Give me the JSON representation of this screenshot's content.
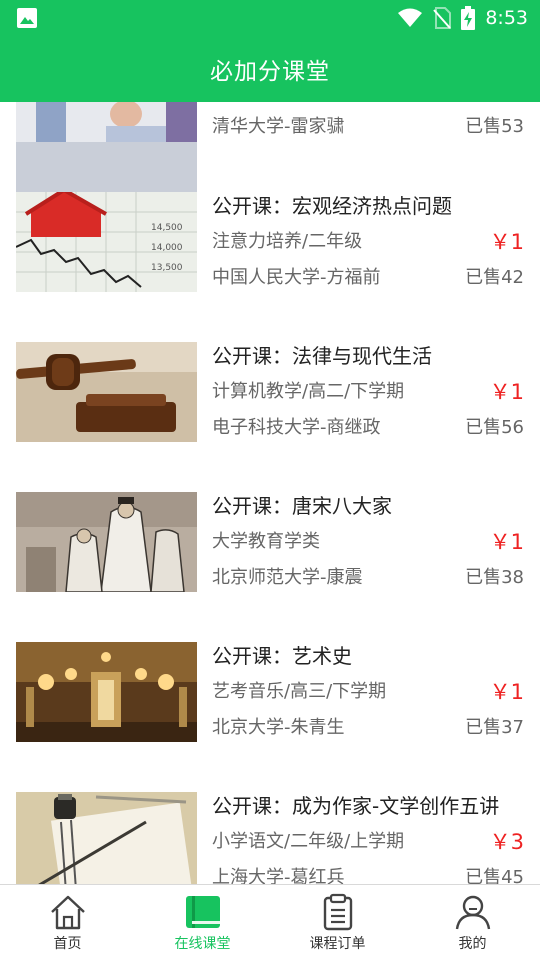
{
  "status_bar": {
    "time": "8:53"
  },
  "header": {
    "title": "必加分课堂"
  },
  "courses": [
    {
      "title": "",
      "category": "",
      "price": "",
      "teacher": "清华大学-雷家骕",
      "sold": "已售53",
      "thumb": "business-people-photo"
    },
    {
      "title": "公开课：宏观经济热点问题",
      "category": "注意力培养/二年级",
      "price": "￥1",
      "teacher": "中国人民大学-方福前",
      "sold": "已售42",
      "thumb": "house-and-stock-chart-photo"
    },
    {
      "title": "公开课：法律与现代生活",
      "category": "计算机教学/高二/下学期",
      "price": "￥1",
      "teacher": "电子科技大学-商继政",
      "sold": "已售56",
      "thumb": "gavel-photo"
    },
    {
      "title": "公开课：唐宋八大家",
      "category": "大学教育学类",
      "price": "￥1",
      "teacher": "北京师范大学-康震",
      "sold": "已售38",
      "thumb": "ancient-scholars-painting"
    },
    {
      "title": "公开课：艺术史",
      "category": "艺考音乐/高三/下学期",
      "price": "￥1",
      "teacher": "北京大学-朱青生",
      "sold": "已售37",
      "thumb": "palace-hall-photo"
    },
    {
      "title": "公开课：成为作家-文学创作五讲",
      "category": "小学语文/二年级/上学期",
      "price": "￥3",
      "teacher": "上海大学-葛红兵",
      "sold": "已售45",
      "thumb": "notebook-and-pen-photo"
    }
  ],
  "tabs": [
    {
      "label": "首页",
      "icon": "home-icon",
      "active": false
    },
    {
      "label": "在线课堂",
      "icon": "book-icon",
      "active": true
    },
    {
      "label": "课程订单",
      "icon": "clipboard-icon",
      "active": false
    },
    {
      "label": "我的",
      "icon": "person-icon",
      "active": false
    }
  ],
  "colors": {
    "brand": "#17c35f",
    "price": "#ee2222"
  }
}
